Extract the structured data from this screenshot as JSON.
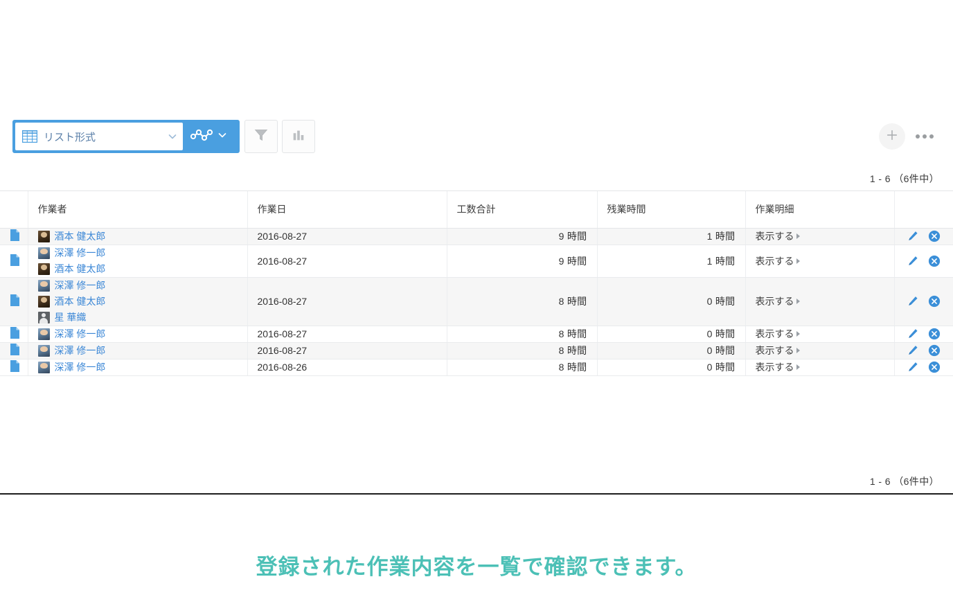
{
  "toolbar": {
    "view_label": "リスト形式",
    "grid_icon": "table-grid-icon",
    "dropdown_icon": "chevron-down-icon",
    "graph_icon": "graph-nodes-icon",
    "graph_dropdown_icon": "chevron-down-icon",
    "filter_icon": "funnel-filter-icon",
    "chart_icon": "bar-chart-icon",
    "add_icon": "plus-icon",
    "more_icon": "ellipsis-icon",
    "accent_color": "#4a9fe0"
  },
  "pagination": {
    "top": "1 - 6 （6件中）",
    "bottom": "1 - 6 （6件中）"
  },
  "table": {
    "columns": [
      "",
      "作業者",
      "作業日",
      "工数合計",
      "残業時間",
      "作業明細",
      ""
    ],
    "record_icon": "document-icon",
    "edit_icon": "pencil-edit-icon",
    "delete_icon": "circle-close-icon",
    "detail_label": "表示する",
    "rows": [
      {
        "workers": [
          {
            "name": "酒本 健太郎",
            "avatar": "a-dark"
          }
        ],
        "date": "2016-08-27",
        "total": "9 時間",
        "overtime": "1 時間",
        "detail": "表示する"
      },
      {
        "workers": [
          {
            "name": "深澤 修一郎",
            "avatar": "a-blue"
          },
          {
            "name": "酒本 健太郎",
            "avatar": "a-dark"
          }
        ],
        "date": "2016-08-27",
        "total": "9 時間",
        "overtime": "1 時間",
        "detail": "表示する"
      },
      {
        "workers": [
          {
            "name": "深澤 修一郎",
            "avatar": "a-blue"
          },
          {
            "name": "酒本 健太郎",
            "avatar": "a-dark"
          },
          {
            "name": "星 華織",
            "avatar": "a-gray"
          }
        ],
        "date": "2016-08-27",
        "total": "8 時間",
        "overtime": "0 時間",
        "detail": "表示する"
      },
      {
        "workers": [
          {
            "name": "深澤 修一郎",
            "avatar": "a-blue"
          }
        ],
        "date": "2016-08-27",
        "total": "8 時間",
        "overtime": "0 時間",
        "detail": "表示する"
      },
      {
        "workers": [
          {
            "name": "深澤 修一郎",
            "avatar": "a-blue"
          }
        ],
        "date": "2016-08-27",
        "total": "8 時間",
        "overtime": "0 時間",
        "detail": "表示する"
      },
      {
        "workers": [
          {
            "name": "深澤 修一郎",
            "avatar": "a-blue"
          }
        ],
        "date": "2016-08-26",
        "total": "8 時間",
        "overtime": "0 時間",
        "detail": "表示する"
      }
    ]
  },
  "caption": {
    "text": "登録された作業内容を一覧で確認できます。",
    "color": "#4cc0b6"
  }
}
